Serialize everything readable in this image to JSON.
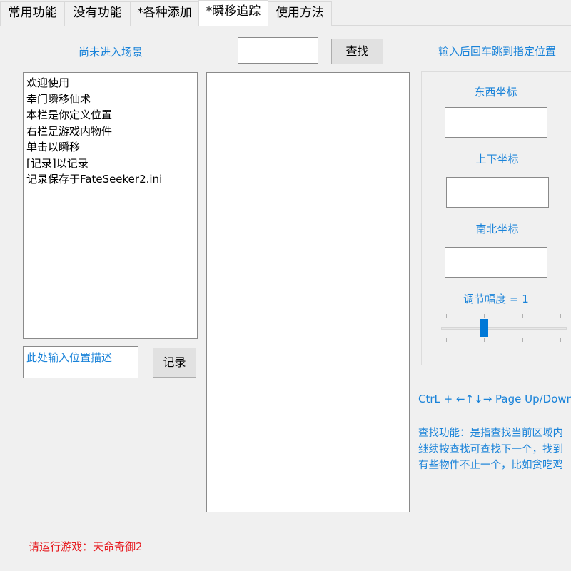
{
  "tabs": [
    {
      "label": "常用功能"
    },
    {
      "label": "没有功能"
    },
    {
      "label": "*各种添加"
    },
    {
      "label": "*瞬移追踪"
    },
    {
      "label": "使用方法"
    }
  ],
  "scene_status": "尚未进入场景",
  "search": {
    "value": "",
    "button_label": "查找"
  },
  "hint_top_right": "输入后回车跳到指定位置",
  "saved_locations": [
    "欢迎使用",
    "幸门瞬移仙术",
    "本栏是你定义位置",
    "右栏是游戏内物件",
    "单击以瞬移",
    "[记录]以记录",
    "记录保存于FateSeeker2.ini"
  ],
  "description_input": {
    "placeholder": "此处输入位置描述"
  },
  "record_button_label": "记录",
  "coords": {
    "east_west_label": "东西坐标",
    "east_west_value": "",
    "up_down_label": "上下坐标",
    "up_down_value": "",
    "south_north_label": "南北坐标",
    "south_north_value": ""
  },
  "step": {
    "label": "调节幅度 = 1",
    "value": 1
  },
  "hotkey_hint": "CtrL + ←↑↓→ Page Up/Down",
  "help_lines": [
    "查找功能：是指查找当前区域内",
    "继续按查找可查找下一个，找到",
    "有些物件不止一个，比如贪吃鸡"
  ],
  "status_message": "请运行游戏：天命奇御2",
  "colors": {
    "accent": "#1a83d9",
    "warning": "#e6191e",
    "slider_thumb": "#0078d7"
  }
}
